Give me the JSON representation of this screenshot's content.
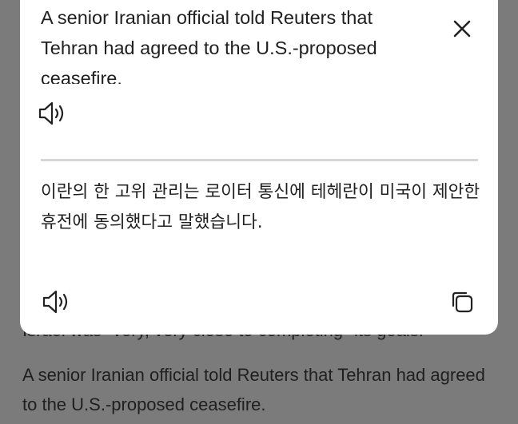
{
  "article": {
    "partial_line": "Israel was \"very, very close to completing\" its goals.",
    "paragraph": "A senior Iranian official told Reuters that Tehran had agreed to the U.S.-proposed ceasefire."
  },
  "translate_panel": {
    "source_text": "A senior Iranian official told Reuters that Tehran had agreed to the U.S.-proposed ceasefire.",
    "translated_text": "이란의 한 고위 관리는 로이터 통신에 테헤란이 미국이 제안한 휴전에 동의했다고 말했습니다.",
    "icons": {
      "close": "close-icon",
      "source_speak": "speaker-icon",
      "translated_speak": "speaker-icon",
      "copy": "copy-icon"
    }
  }
}
